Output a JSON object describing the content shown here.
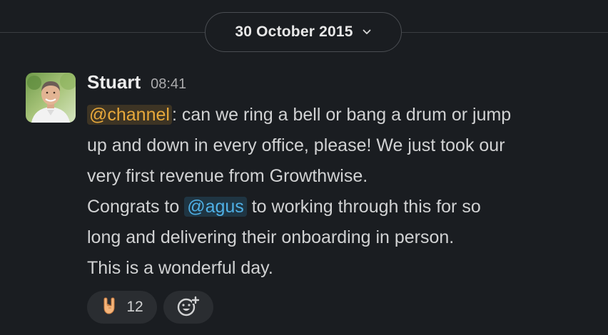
{
  "date_divider": {
    "label": "30 October 2015"
  },
  "message": {
    "author": "Stuart",
    "time": "08:41",
    "segments": [
      {
        "type": "mention",
        "text": "@channel"
      },
      {
        "type": "text",
        "text": ": can we ring a bell or bang a drum or jump"
      },
      {
        "type": "text",
        "text": "up and down in every office, please! We just took our"
      },
      {
        "type": "text",
        "text": "very first revenue from Growthwise."
      },
      {
        "type": "text",
        "text": "Congrats to "
      },
      {
        "type": "mention",
        "text": "@agus"
      },
      {
        "type": "text",
        "text": " to working through this for so"
      },
      {
        "type": "text",
        "text": "long and delivering their onboarding in person."
      },
      {
        "type": "text",
        "text": "This is a wonderful day."
      }
    ],
    "reactions": [
      {
        "emoji": "sign-of-the-horns",
        "count": "12"
      }
    ]
  },
  "colors": {
    "background": "#1a1d21",
    "channel_mention": "#e8a93b",
    "user_mention": "#4fb0e6"
  }
}
